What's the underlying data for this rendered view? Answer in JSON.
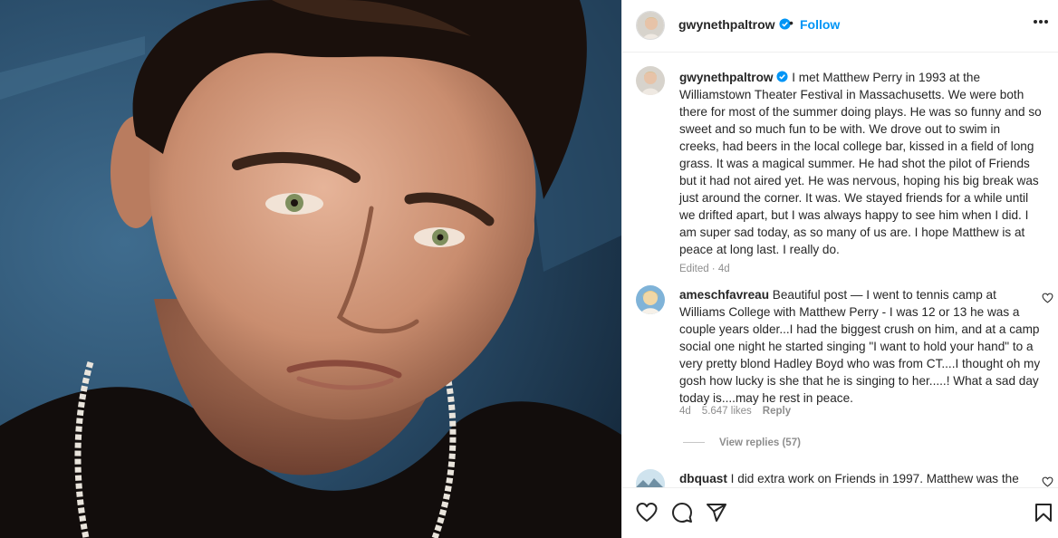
{
  "post": {
    "username": "gwynethpaltrow",
    "separator": "•",
    "follow_label": "Follow",
    "caption": "I met Matthew Perry in 1993 at the Williamstown Theater Festival in Massachusetts. We were both there for most of the summer doing plays. He was so funny and so sweet and so much fun to be with. We drove out to swim in creeks, had beers in the local college bar, kissed in a field of long grass. It was a magical summer. He had shot the pilot of Friends but it had not aired yet. He was nervous, hoping his big break was just around the corner. It was. We stayed friends for a while until we drifted apart, but I was always happy to see him when I did. I am super sad today, as so many of us are. I hope Matthew is at peace at long last. I really do.",
    "caption_meta": "Edited · 4d"
  },
  "comments": [
    {
      "username": "ameschfavreau",
      "text": "Beautiful post — I went to tennis camp at Williams College with Matthew Perry - I was 12 or 13 he was a couple years older...I had the biggest crush on him, and at a camp social one night he started singing \"I want to hold your hand\" to a very pretty blond Hadley Boyd who was from CT....I thought oh my gosh how lucky is she that he is singing to her.....! What a sad day today is....may he rest in peace.",
      "age": "4d",
      "likes": "5.647 likes",
      "reply_label": "Reply",
      "view_replies": "View replies (57)"
    },
    {
      "username": "dbquast",
      "text": "I did extra work on Friends in 1997. Matthew was the"
    }
  ],
  "icons": {
    "verified": "verified-badge-icon",
    "more": "more-options-icon",
    "like": "heart-icon",
    "comment": "comment-icon",
    "share": "share-icon",
    "save": "bookmark-icon"
  },
  "colors": {
    "accent": "#0095f6",
    "text": "#262626",
    "muted": "#8e8e8e",
    "divider": "#efefef"
  }
}
